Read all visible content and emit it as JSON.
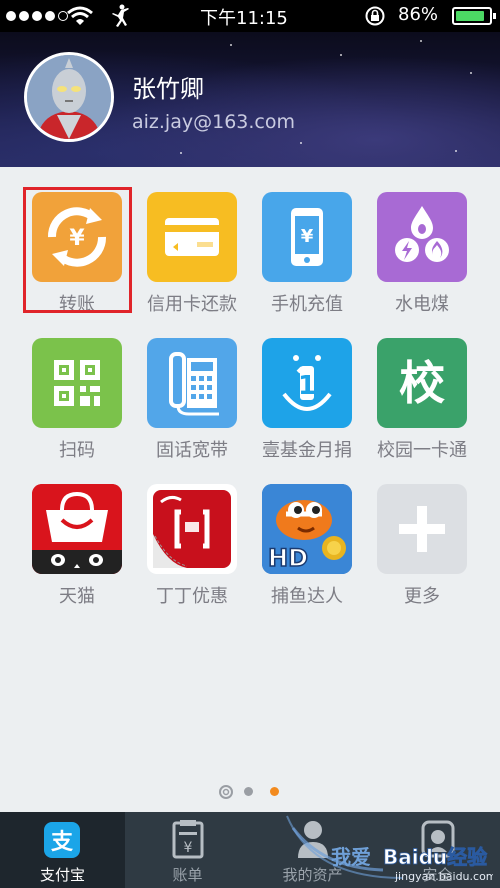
{
  "status_bar": {
    "time": "下午11:15",
    "battery_percent": "86%",
    "battery_level": 0.86
  },
  "profile": {
    "name": "张竹卿",
    "email": "aiz.jay@163.com"
  },
  "apps": [
    {
      "label": "转账",
      "icon": "transfer-icon",
      "color": "#f1a23a"
    },
    {
      "label": "信用卡还款",
      "icon": "credit-card-icon",
      "color": "#f7bd22"
    },
    {
      "label": "手机充值",
      "icon": "phone-topup-icon",
      "color": "#48a6ea"
    },
    {
      "label": "水电煤",
      "icon": "utilities-icon",
      "color": "#a86ad4"
    },
    {
      "label": "扫码",
      "icon": "qr-code-icon",
      "color": "#7bc24b"
    },
    {
      "label": "固话宽带",
      "icon": "landline-icon",
      "color": "#52a6e9"
    },
    {
      "label": "壹基金月捐",
      "icon": "charity-icon",
      "color": "#1ea3e8"
    },
    {
      "label": "校园一卡通",
      "icon": "campus-card-icon",
      "color": "#3aa26a",
      "glyph": "校"
    },
    {
      "label": "天猫",
      "icon": "tmall-icon",
      "color": "#d9141c"
    },
    {
      "label": "丁丁优惠",
      "icon": "dingding-icon",
      "color": "#c8101c"
    },
    {
      "label": "捕鱼达人",
      "icon": "fishing-game-icon",
      "color": "#2b6ab8",
      "badge": "HD"
    },
    {
      "label": "更多",
      "icon": "more-icon",
      "color": "#dcdfe3"
    }
  ],
  "pager": {
    "pages": 3,
    "active": 3
  },
  "tabs": [
    {
      "label": "支付宝",
      "icon": "alipay-icon",
      "active": true
    },
    {
      "label": "账单",
      "icon": "bill-icon",
      "active": false
    },
    {
      "label": "我的资产",
      "icon": "assets-icon",
      "active": false
    },
    {
      "label": "安全",
      "icon": "security-icon",
      "active": false
    }
  ],
  "watermark": {
    "text": "Baidu经验",
    "sub": "jingyan.baidu.com",
    "prefix": "我爱"
  }
}
